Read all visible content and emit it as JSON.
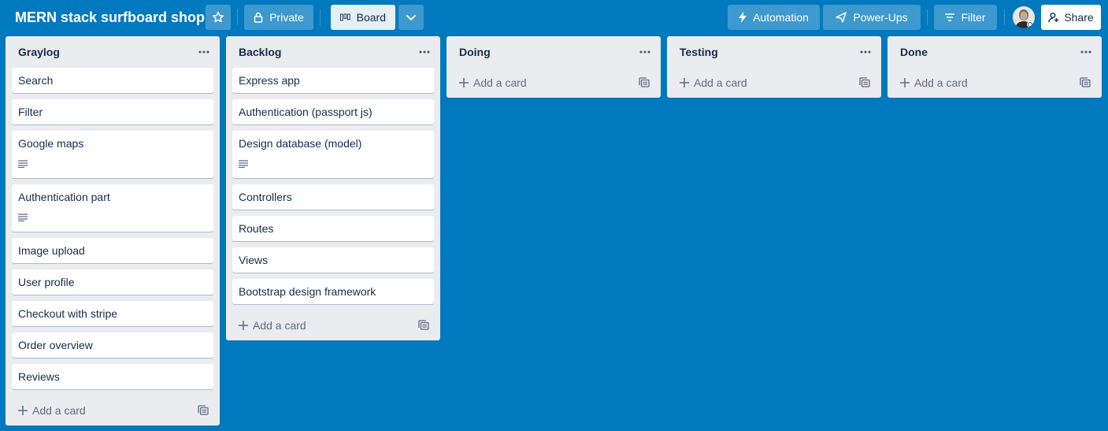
{
  "header": {
    "board_title": "MERN stack surfboard shop",
    "visibility_label": "Private",
    "view_label": "Board",
    "automation_label": "Automation",
    "powerups_label": "Power-Ups",
    "filter_label": "Filter",
    "share_label": "Share"
  },
  "add_card_label": "Add a card",
  "lists": [
    {
      "title": "Graylog",
      "cards": [
        {
          "title": "Search",
          "has_description": false
        },
        {
          "title": "Filter",
          "has_description": false
        },
        {
          "title": "Google maps",
          "has_description": true
        },
        {
          "title": "Authentication part",
          "has_description": true
        },
        {
          "title": "Image upload",
          "has_description": false
        },
        {
          "title": "User profile",
          "has_description": false
        },
        {
          "title": "Checkout with stripe",
          "has_description": false
        },
        {
          "title": "Order overview",
          "has_description": false
        },
        {
          "title": "Reviews",
          "has_description": false
        }
      ]
    },
    {
      "title": "Backlog",
      "cards": [
        {
          "title": "Express app",
          "has_description": false
        },
        {
          "title": "Authentication (passport js)",
          "has_description": false
        },
        {
          "title": "Design database (model)",
          "has_description": true
        },
        {
          "title": "Controllers",
          "has_description": false
        },
        {
          "title": "Routes",
          "has_description": false
        },
        {
          "title": "Views",
          "has_description": false
        },
        {
          "title": "Bootstrap design framework",
          "has_description": false
        }
      ]
    },
    {
      "title": "Doing",
      "cards": []
    },
    {
      "title": "Testing",
      "cards": []
    },
    {
      "title": "Done",
      "cards": []
    }
  ],
  "colors": {
    "board_background": "#0079bf",
    "list_background": "#ebecf0",
    "card_background": "#ffffff",
    "text_primary": "#172b4d",
    "text_muted": "#5e6c84"
  }
}
